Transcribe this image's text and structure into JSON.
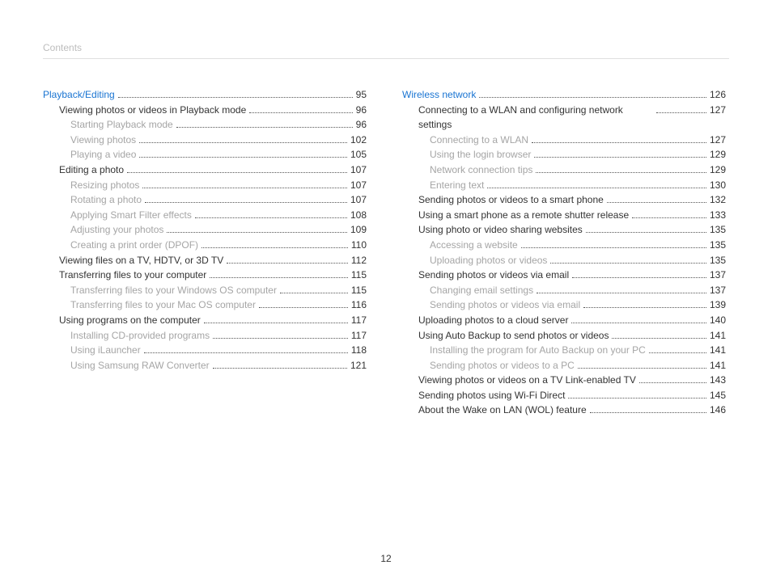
{
  "header": "Contents",
  "page_number": "12",
  "left": [
    {
      "t": "chapter",
      "label": "Playback/Editing",
      "pg": "95",
      "indent": 0
    },
    {
      "t": "topic",
      "label": "Viewing photos or videos in Playback mode",
      "pg": "96",
      "indent": 1
    },
    {
      "t": "sub",
      "label": "Starting Playback mode",
      "pg": "96",
      "indent": 2
    },
    {
      "t": "sub",
      "label": "Viewing photos",
      "pg": "102",
      "indent": 2
    },
    {
      "t": "sub",
      "label": "Playing a video",
      "pg": "105",
      "indent": 2
    },
    {
      "t": "topic",
      "label": "Editing a photo",
      "pg": "107",
      "indent": 1
    },
    {
      "t": "sub",
      "label": "Resizing photos",
      "pg": "107",
      "indent": 2
    },
    {
      "t": "sub",
      "label": "Rotating a photo",
      "pg": "107",
      "indent": 2
    },
    {
      "t": "sub",
      "label": "Applying Smart Filter effects",
      "pg": "108",
      "indent": 2
    },
    {
      "t": "sub",
      "label": "Adjusting your photos",
      "pg": "109",
      "indent": 2
    },
    {
      "t": "sub",
      "label": "Creating a print order (DPOF)",
      "pg": "110",
      "indent": 2
    },
    {
      "t": "topic",
      "label": "Viewing files on a TV, HDTV, or 3D TV",
      "pg": "112",
      "indent": 1
    },
    {
      "t": "topic",
      "label": "Transferring files to your computer",
      "pg": "115",
      "indent": 1
    },
    {
      "t": "sub",
      "label": "Transferring files to your Windows OS computer",
      "pg": "115",
      "indent": 2
    },
    {
      "t": "sub",
      "label": "Transferring files to your Mac OS computer",
      "pg": "116",
      "indent": 2
    },
    {
      "t": "topic",
      "label": "Using programs on the computer",
      "pg": "117",
      "indent": 1
    },
    {
      "t": "sub",
      "label": "Installing CD-provided programs",
      "pg": "117",
      "indent": 2
    },
    {
      "t": "sub",
      "label": "Using iLauncher",
      "pg": "118",
      "indent": 2
    },
    {
      "t": "sub",
      "label": "Using Samsung RAW Converter",
      "pg": "121",
      "indent": 2
    }
  ],
  "right": [
    {
      "t": "chapter",
      "label": "Wireless network",
      "pg": "126",
      "indent": 0
    },
    {
      "t": "topic",
      "label": "Connecting to a WLAN and configuring network settings",
      "pg": "127",
      "indent": 1,
      "wrap": true
    },
    {
      "t": "sub",
      "label": "Connecting to a WLAN",
      "pg": "127",
      "indent": 2
    },
    {
      "t": "sub",
      "label": "Using the login browser",
      "pg": "129",
      "indent": 2
    },
    {
      "t": "sub",
      "label": "Network connection tips",
      "pg": "129",
      "indent": 2
    },
    {
      "t": "sub",
      "label": "Entering text",
      "pg": "130",
      "indent": 2
    },
    {
      "t": "topic",
      "label": "Sending photos or videos to a smart phone",
      "pg": "132",
      "indent": 1
    },
    {
      "t": "topic",
      "label": "Using a smart phone as a remote shutter release",
      "pg": "133",
      "indent": 1
    },
    {
      "t": "topic",
      "label": "Using photo or video sharing websites",
      "pg": "135",
      "indent": 1
    },
    {
      "t": "sub",
      "label": "Accessing a website",
      "pg": "135",
      "indent": 2
    },
    {
      "t": "sub",
      "label": "Uploading photos or videos",
      "pg": "135",
      "indent": 2
    },
    {
      "t": "topic",
      "label": "Sending photos or videos via email",
      "pg": "137",
      "indent": 1
    },
    {
      "t": "sub",
      "label": "Changing email settings",
      "pg": "137",
      "indent": 2
    },
    {
      "t": "sub",
      "label": "Sending photos or videos via email",
      "pg": "139",
      "indent": 2
    },
    {
      "t": "topic",
      "label": "Uploading photos to a cloud server",
      "pg": "140",
      "indent": 1
    },
    {
      "t": "topic",
      "label": "Using Auto Backup to send photos or videos",
      "pg": "141",
      "indent": 1
    },
    {
      "t": "sub",
      "label": "Installing the program for Auto Backup on your PC",
      "pg": "141",
      "indent": 2
    },
    {
      "t": "sub",
      "label": "Sending photos or videos to a PC",
      "pg": "141",
      "indent": 2
    },
    {
      "t": "topic",
      "label": "Viewing photos or videos on a TV Link-enabled TV",
      "pg": "143",
      "indent": 1,
      "wrap": true
    },
    {
      "t": "topic",
      "label": "Sending photos using Wi-Fi Direct",
      "pg": "145",
      "indent": 1
    },
    {
      "t": "topic",
      "label": "About the Wake on LAN (WOL) feature",
      "pg": "146",
      "indent": 1
    }
  ]
}
